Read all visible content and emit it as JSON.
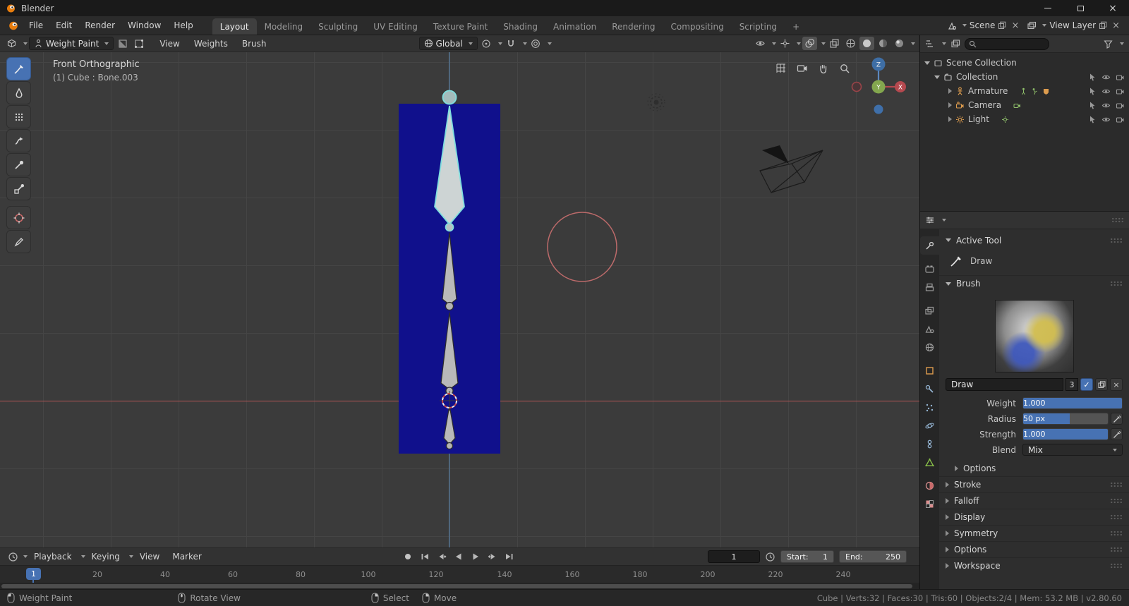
{
  "window": {
    "title": "Blender"
  },
  "topbar": {
    "menus": [
      "File",
      "Edit",
      "Render",
      "Window",
      "Help"
    ],
    "tabs": [
      "Layout",
      "Modeling",
      "Sculpting",
      "UV Editing",
      "Texture Paint",
      "Shading",
      "Animation",
      "Rendering",
      "Compositing",
      "Scripting"
    ],
    "new_tab_label": "+",
    "scene_label": "Scene",
    "view_layer_label": "View Layer"
  },
  "viewport_header": {
    "mode": "Weight Paint",
    "menus": [
      "View",
      "Weights",
      "Brush"
    ],
    "orientation": "Global"
  },
  "viewport": {
    "view_label": "Front Orthographic",
    "context_label": "(1) Cube : Bone.003",
    "gizmo": {
      "z_label": "Z",
      "y_label": "Y"
    }
  },
  "outliner": {
    "rows": [
      {
        "label": "Scene Collection"
      },
      {
        "label": "Collection"
      },
      {
        "label": "Armature"
      },
      {
        "label": "Camera"
      },
      {
        "label": "Light"
      }
    ]
  },
  "properties": {
    "active_tool": {
      "header": "Active Tool",
      "tool_name": "Draw"
    },
    "brush": {
      "header": "Brush",
      "name": "Draw",
      "users": "3",
      "fields": [
        {
          "label": "Weight",
          "value": "1.000"
        },
        {
          "label": "Radius",
          "value": "50 px"
        },
        {
          "label": "Strength",
          "value": "1.000"
        },
        {
          "label": "Blend",
          "value": "Mix"
        }
      ],
      "sub_panel": "Options"
    },
    "panels": [
      "Stroke",
      "Falloff",
      "Display",
      "Symmetry",
      "Options",
      "Workspace"
    ]
  },
  "timeline": {
    "menus": [
      "Playback",
      "Keying",
      "View",
      "Marker"
    ],
    "current_frame": "1",
    "start_label": "Start:",
    "start_value": "1",
    "end_label": "End:",
    "end_value": "250",
    "marker_label": "1",
    "ticks": [
      "20",
      "40",
      "60",
      "80",
      "100",
      "120",
      "140",
      "160",
      "180",
      "200",
      "220",
      "240"
    ]
  },
  "statusbar": {
    "items": [
      {
        "label": "Weight Paint"
      },
      {
        "label": "Rotate View"
      },
      {
        "label": "Select"
      },
      {
        "label": "Move"
      }
    ],
    "stats": "Cube | Verts:32 | Faces:30 | Tris:60 | Objects:2/4 | Mem: 53.2 MB | v2.80.60"
  },
  "colors": {
    "accent": "#4772b3",
    "cube_weight_zero": "#10108c",
    "bone_selected_outline": "#7fdede",
    "axis_x": "#b25555",
    "axis_z": "#5b8ab8",
    "gizmo_x": "#b5494f",
    "gizmo_y": "#83a74e",
    "gizmo_z": "#3e6ea5"
  }
}
